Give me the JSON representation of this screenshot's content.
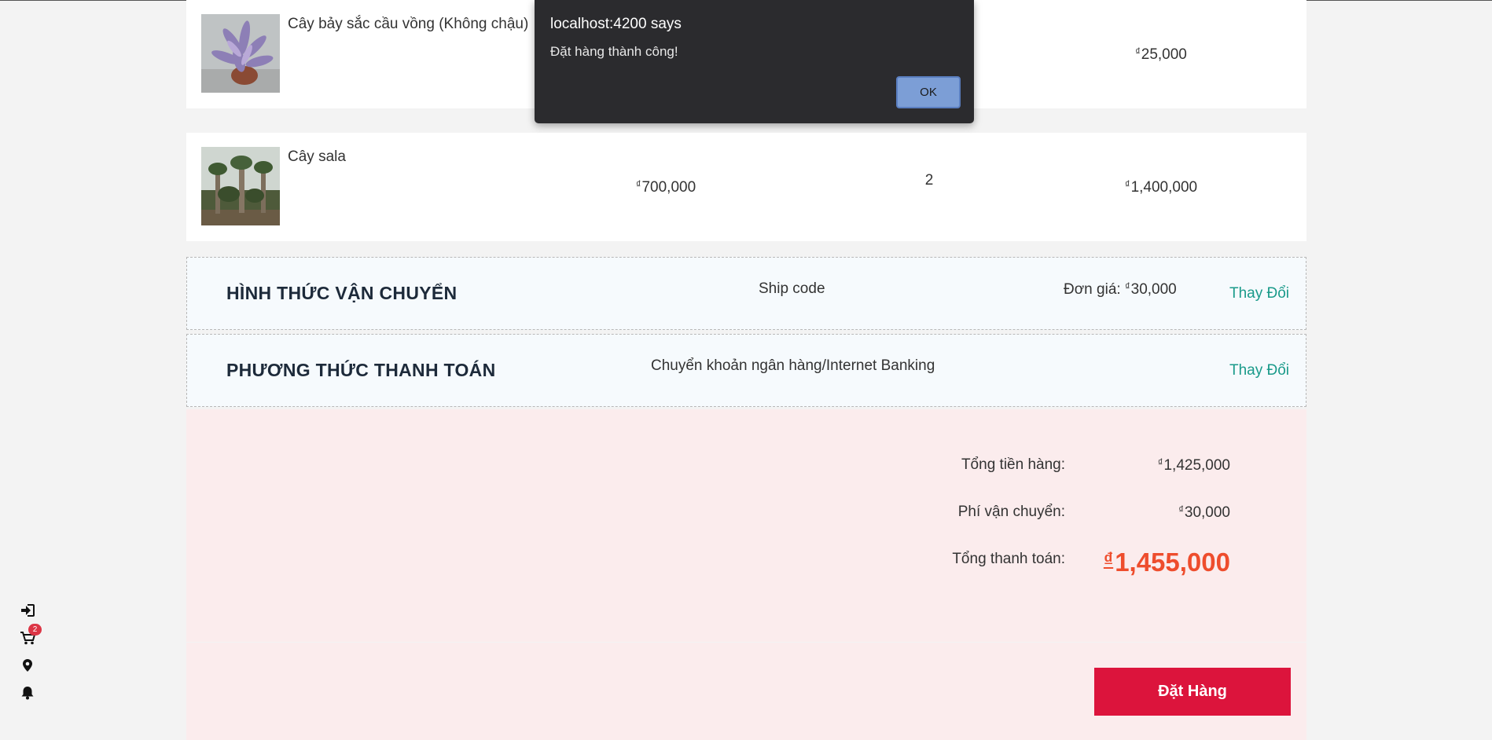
{
  "cart_items": [
    {
      "name": "Cây bảy sắc cầu vồng (Không chậu)",
      "currency": "₫",
      "total": "25,000"
    },
    {
      "name": "Cây sala",
      "currency": "₫",
      "price": "700,000",
      "quantity": "2",
      "total": "1,400,000"
    }
  ],
  "shipping": {
    "title": "HÌNH THỨC VẬN CHUYỂN",
    "method": "Ship code",
    "price_label": "Đơn giá:",
    "currency": "₫",
    "price": "30,000",
    "change_label": "Thay Đổi"
  },
  "payment": {
    "title": "PHƯƠNG THỨC THANH TOÁN",
    "method": "Chuyển khoản ngân hàng/Internet Banking",
    "change_label": "Thay Đổi"
  },
  "summary": {
    "subtotal_label": "Tổng tiền hàng:",
    "subtotal_currency": "₫",
    "subtotal": "1,425,000",
    "shipping_label": "Phí vận chuyển:",
    "shipping_currency": "₫",
    "shipping": "30,000",
    "grand_label": "Tổng thanh toán:",
    "grand_currency": "₫",
    "grand_total": "1,455,000"
  },
  "order_button": "Đặt Hàng",
  "sidebar": {
    "icons": [
      "sign-in-icon",
      "cart-icon",
      "location-pin-icon",
      "bell-icon"
    ],
    "cart_count": "2"
  },
  "dialog": {
    "title": "localhost:4200 says",
    "message": "Đặt hàng thành công!",
    "ok_label": "OK"
  },
  "colors": {
    "accent_red": "#dc143c",
    "total_orange": "#ee4d2d",
    "link_teal": "#1a9a8a",
    "summary_bg": "#fbeced"
  }
}
